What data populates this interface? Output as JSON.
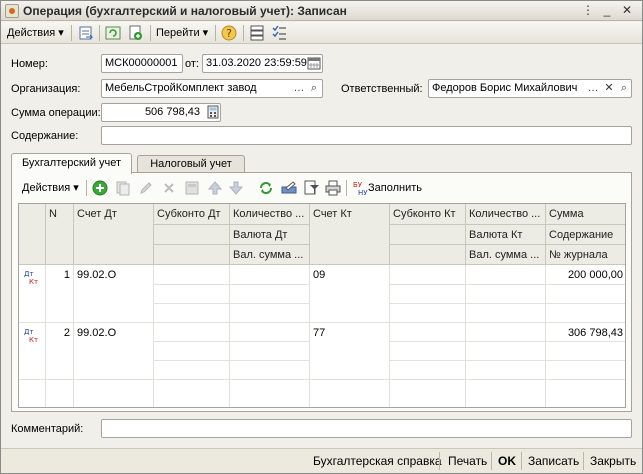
{
  "window": {
    "title": "Операция (бухгалтерский и налоговый учет): Записан"
  },
  "toolbar": {
    "actions_label": "Действия",
    "goto_label": "Перейти"
  },
  "form": {
    "number_label": "Номер:",
    "number_value": "МСК00000001",
    "date_label": "от:",
    "date_value": "31.03.2020 23:59:59",
    "org_label": "Организация:",
    "org_value": "МебельСтройКомплект завод",
    "resp_label": "Ответственный:",
    "resp_value": "Федоров Борис Михайлович",
    "sum_label": "Сумма операции:",
    "sum_value": "506 798,43",
    "content_label": "Содержание:",
    "content_value": "",
    "comment_label": "Комментарий:",
    "comment_value": ""
  },
  "tabs": [
    {
      "label": "Бухгалтерский учет"
    },
    {
      "label": "Налоговый учет"
    }
  ],
  "table_toolbar": {
    "actions_label": "Действия",
    "fill_label": "Заполнить"
  },
  "table": {
    "headers": {
      "n": "N",
      "dt": "Счет Дт",
      "subdt": "Субконто Дт",
      "qty_dt": "Количество ...",
      "cur_dt": "Валюта Дт",
      "cursum_dt": "Вал. сумма ...",
      "kt": "Счет Кт",
      "subkt": "Субконто Кт",
      "qty_kt": "Количество ...",
      "cur_kt": "Валюта Кт",
      "cursum_kt": "Вал. сумма ...",
      "sum": "Сумма",
      "content": "Содержание",
      "journal": "№ журнала"
    },
    "rows": [
      {
        "icon_top": "Дт",
        "icon_bottom": "Кт",
        "n": "1",
        "dt": "99.02.О",
        "kt": "09",
        "sum": "200 000,00"
      },
      {
        "icon_top": "Дт",
        "icon_bottom": "Кт",
        "n": "2",
        "dt": "99.02.О",
        "kt": "77",
        "sum": "306 798,43"
      }
    ]
  },
  "footer": {
    "report_label": "Бухгалтерская справка",
    "print_label": "Печать",
    "ok_label": "OK",
    "save_label": "Записать",
    "close_label": "Закрыть"
  },
  "colors": {
    "accent_green": "#2e9a2e",
    "dt_red": "#c0201e",
    "dt_blue": "#1f3f9f"
  }
}
